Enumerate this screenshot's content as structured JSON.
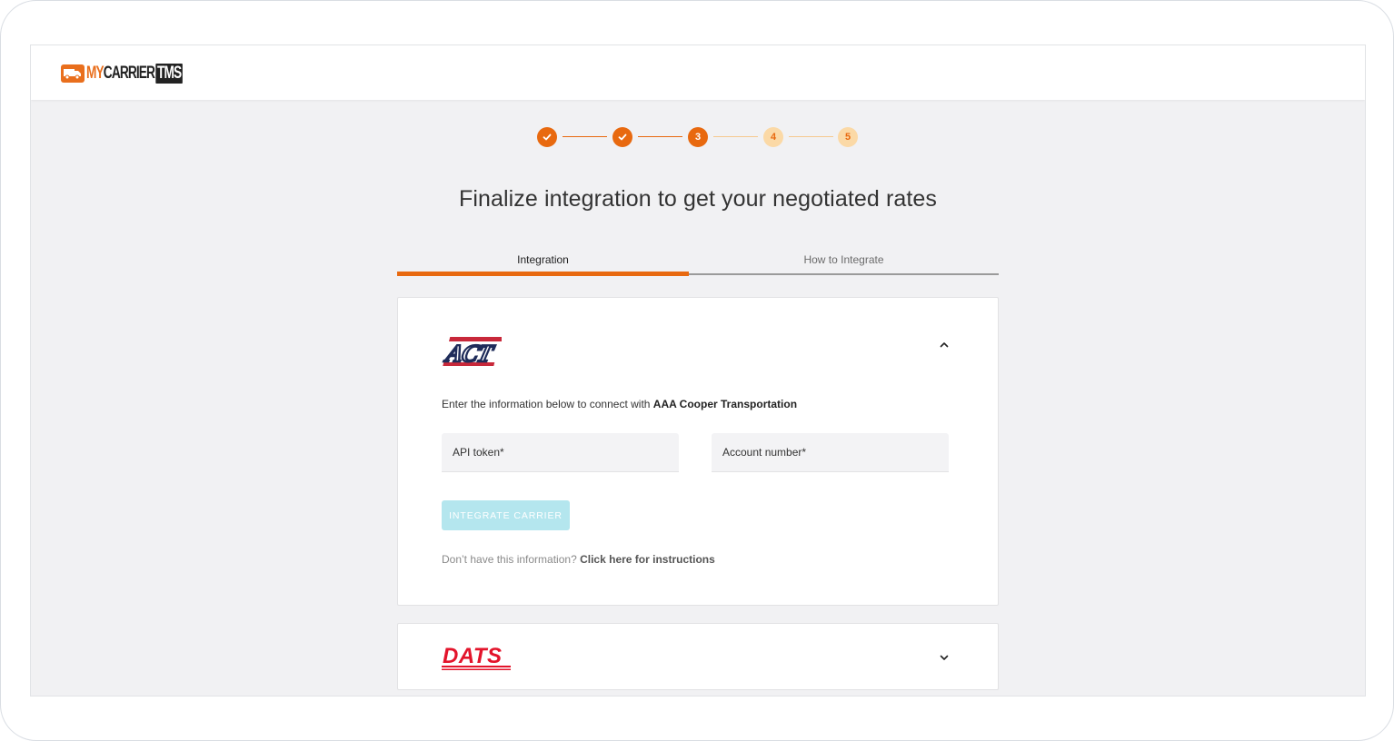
{
  "brand": {
    "logo_my": "MY",
    "logo_carrier": "CARRIER",
    "logo_tms": "TMS",
    "accent": "#e8690f"
  },
  "stepper": {
    "steps": [
      {
        "state": "done",
        "label": ""
      },
      {
        "state": "done",
        "label": ""
      },
      {
        "state": "active",
        "label": "3"
      },
      {
        "state": "pending",
        "label": "4"
      },
      {
        "state": "pending",
        "label": "5"
      }
    ]
  },
  "page": {
    "title": "Finalize integration to get your negotiated rates"
  },
  "tabs": [
    {
      "label": "Integration",
      "selected": true
    },
    {
      "label": "How to Integrate",
      "selected": false
    }
  ],
  "carriers": [
    {
      "logo_text": "ACT",
      "expanded": true,
      "intro_prefix": "Enter the information below to connect with ",
      "carrier_name": "AAA Cooper Transportation",
      "fields": [
        {
          "placeholder": "API token*",
          "value": ""
        },
        {
          "placeholder": "Account number*",
          "value": ""
        }
      ],
      "button_label": "INTEGRATE CARRIER",
      "help_prefix": "Don’t have this information? ",
      "help_link": "Click here for instructions"
    },
    {
      "logo_text": "DATS",
      "expanded": false
    }
  ]
}
